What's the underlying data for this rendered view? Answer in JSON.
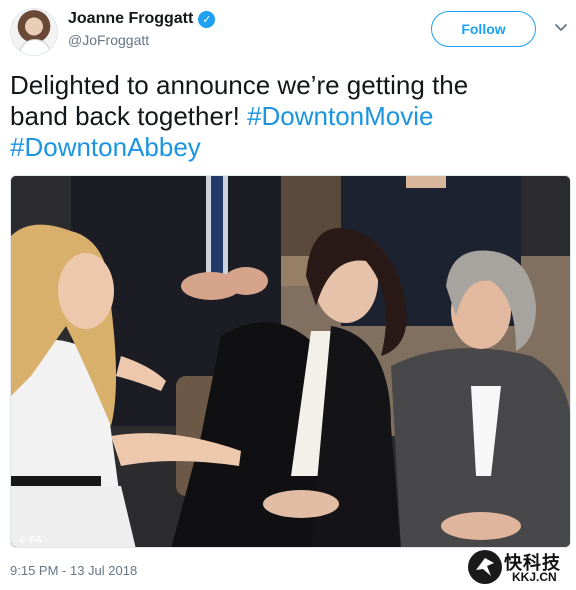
{
  "header": {
    "display_name": "Joanne Froggatt",
    "handle": "@JoFroggatt",
    "verified_symbol": "✓",
    "follow_label": "Follow",
    "caret_icon": "chevron-down-icon"
  },
  "tweet": {
    "text_line1": "Delighted to announce we’re getting the",
    "text_line2_plain": "band back together! ",
    "hashtag1": "#DowntonMovie",
    "hashtag2": "#DowntonAbbey"
  },
  "photo": {
    "credit": "© PA"
  },
  "footer": {
    "timestamp": "9:15 PM - 13 Jul 2018"
  },
  "watermark": {
    "text": "快科技",
    "domain": "KKJ.CN"
  },
  "colors": {
    "accent": "#1da1f2",
    "hashtag": "#1b95e0",
    "secondary_text": "#657786"
  }
}
